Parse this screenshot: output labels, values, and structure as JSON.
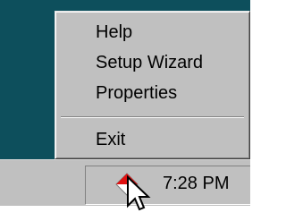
{
  "context_menu": {
    "items": [
      {
        "label": "Help"
      },
      {
        "label": "Setup Wizard"
      },
      {
        "label": "Properties"
      },
      {
        "label": "Exit"
      }
    ]
  },
  "taskbar": {
    "tray": {
      "icon": "red-white-diamond-tray-icon",
      "clock": "7:28 PM"
    }
  },
  "colors": {
    "desktop": "#0d4f5c",
    "taskbar": "#c0c0c0",
    "tray_icon_red": "#e01010"
  }
}
